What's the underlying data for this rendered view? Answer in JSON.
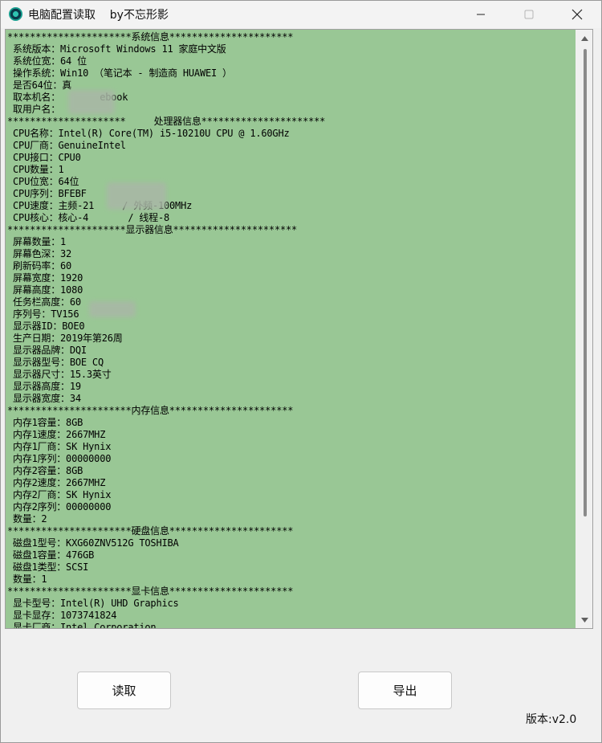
{
  "window": {
    "title": "电脑配置读取    by不忘形影"
  },
  "log_lines": [
    "**********************系统信息**********************",
    " 系统版本：Microsoft Windows 11 家庭中文版",
    " 系统位宽：64 位",
    " 操作系统：Win10 （笔记本 - 制造商 HUAWEI ）",
    " 是否64位：真",
    " 取本机名：       ebook",
    " 取用户名：",
    "*********************     处理器信息**********************",
    " CPU名称：Intel(R) Core(TM) i5-10210U CPU @ 1.60GHz",
    " CPU厂商：GenuineIntel",
    " CPU接口：CPU0",
    " CPU数量：1",
    " CPU位宽：64位",
    " CPU序列：BFEBF",
    " CPU速度：主频-21     / 外频-100MHz",
    " CPU核心：核心-4       / 线程-8",
    "*********************显示器信息**********************",
    " 屏幕数量：1",
    " 屏幕色深：32",
    " 刷新码率：60",
    " 屏幕宽度：1920",
    " 屏幕高度：1080",
    " 任务栏高度：60",
    " 序列号：TV156",
    " 显示器ID：BOE0",
    " 生产日期：2019年第26周",
    " 显示器品牌：DQI",
    " 显示器型号：BOE CQ",
    " 显示器尺寸：15.3英寸",
    " 显示器高度：19",
    " 显示器宽度：34",
    "**********************内存信息**********************",
    " 内存1容量：8GB",
    " 内存1速度：2667MHZ",
    " 内存1厂商：SK Hynix",
    " 内存1序列：00000000",
    " 内存2容量：8GB",
    " 内存2速度：2667MHZ",
    " 内存2厂商：SK Hynix",
    " 内存2序列：00000000",
    " 数量：2",
    "**********************硬盘信息**********************",
    " 磁盘1型号：KXG60ZNV512G TOSHIBA",
    " 磁盘1容量：476GB",
    " 磁盘1类型：SCSI",
    " 数量：1",
    "**********************显卡信息**********************",
    " 显卡型号：Intel(R) UHD Graphics",
    " 显卡显存：1073741824",
    " 显卡厂商：Intel Corporation"
  ],
  "buttons": {
    "read_label": "读取",
    "export_label": "导出"
  },
  "version_label": "版本:v2.0",
  "icons": {
    "app": "app-logo-icon",
    "minimize": "minimize-icon",
    "maximize": "maximize-icon",
    "close": "close-icon"
  },
  "colors": {
    "log_background": "#99c795",
    "window_background": "#f0f0f0"
  }
}
